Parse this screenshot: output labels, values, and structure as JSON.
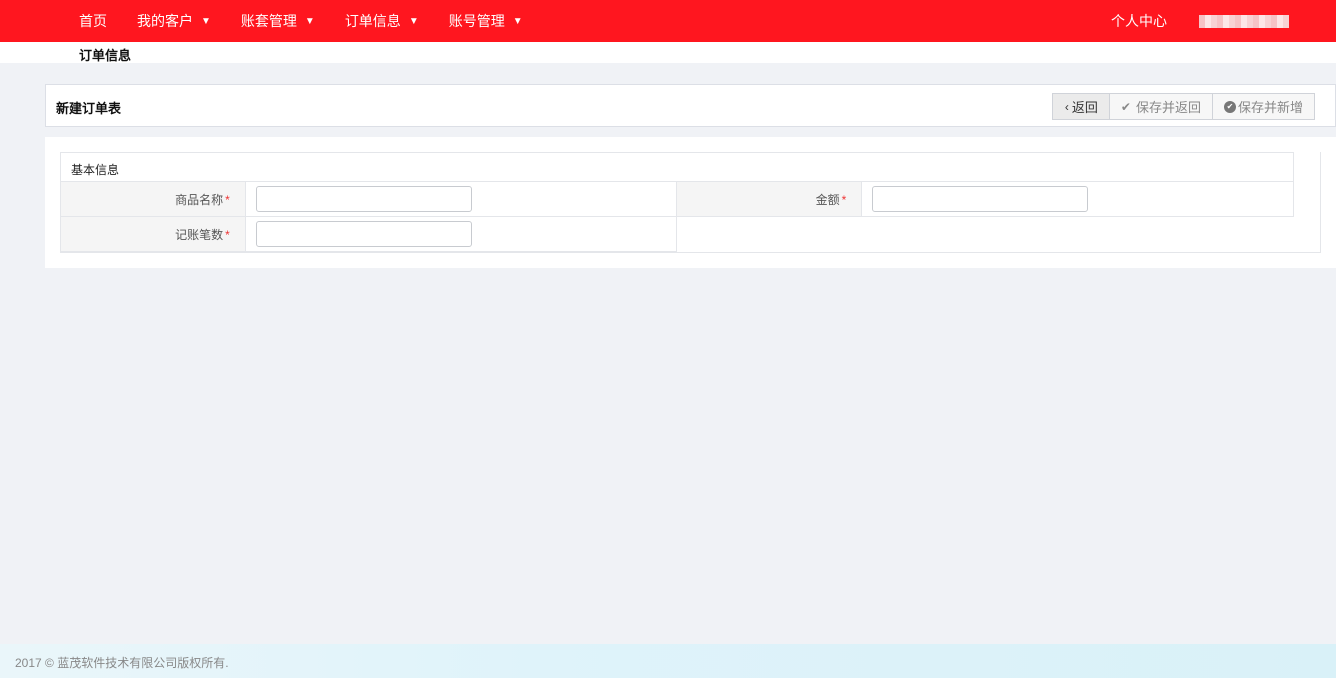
{
  "nav": {
    "items": [
      {
        "label": "首页",
        "dropdown": false
      },
      {
        "label": "我的客户",
        "dropdown": true
      },
      {
        "label": "账套管理",
        "dropdown": true
      },
      {
        "label": "订单信息",
        "dropdown": true
      },
      {
        "label": "账号管理",
        "dropdown": true
      }
    ],
    "personal_center": "个人中心",
    "caret_icon": "▼"
  },
  "breadcrumb": "订单信息",
  "form": {
    "title": "新建订单表",
    "buttons": {
      "back": "返回",
      "save_return": "保存并返回",
      "save_new": "保存并新增"
    },
    "section_title": "基本信息",
    "fields": {
      "product_name": {
        "label": "商品名称",
        "value": ""
      },
      "amount": {
        "label": "金额",
        "value": ""
      },
      "entry_count": {
        "label": "记账笔数",
        "value": ""
      }
    },
    "required_mark": "*"
  },
  "footer": "2017 © 蓝茂软件技术有限公司版权所有.",
  "colors": {
    "brand": "#ff161f",
    "required": "#e33333"
  }
}
